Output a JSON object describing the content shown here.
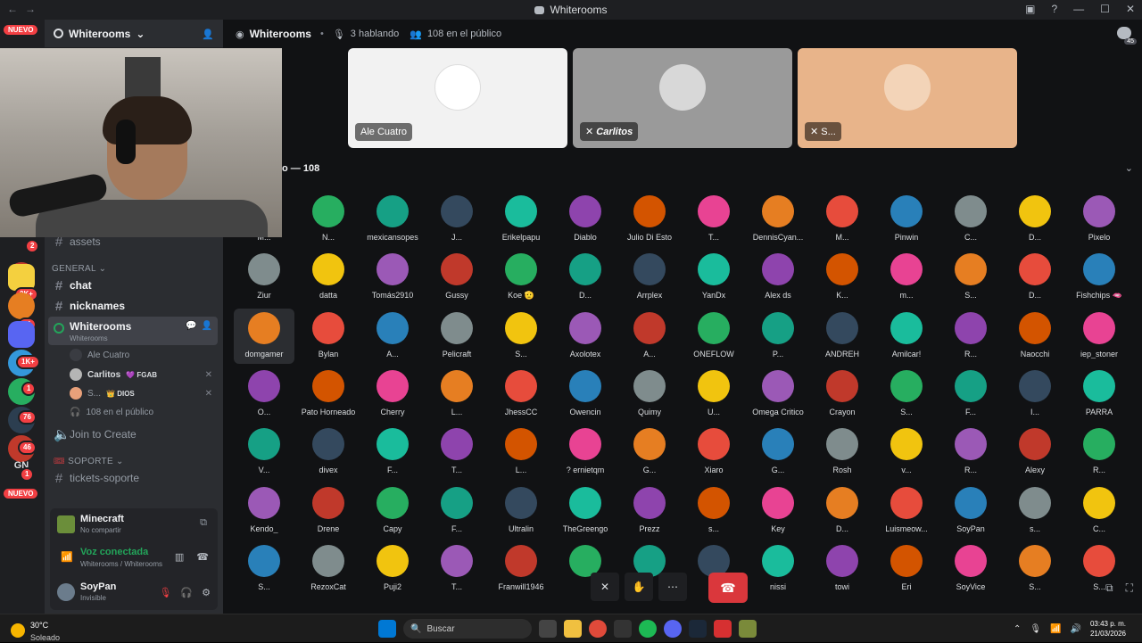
{
  "window": {
    "title": "Whiterooms"
  },
  "rail": {
    "nuevo_top": "NUEVO",
    "nuevo_bottom": "NUEVO",
    "gn": "GN",
    "badges": [
      "2",
      "2K+",
      "21",
      "1K+",
      "1",
      "76",
      "46",
      "1"
    ]
  },
  "sidebar": {
    "server_name": "Whiterooms",
    "channels_top": [
      {
        "label": "assets"
      }
    ],
    "category_general": "GENERAL",
    "channels_general": [
      {
        "label": "chat"
      },
      {
        "label": "nicknames"
      }
    ],
    "voice": {
      "name": "Whiterooms",
      "subtitle": "Whiterooms",
      "users": [
        {
          "name": "Ale Cuatro",
          "role": ""
        },
        {
          "name": "Carlitos",
          "role": "💜 FGAB"
        },
        {
          "name": "S...",
          "role": "👑 DIOS"
        }
      ],
      "audience": "108 en el público"
    },
    "join_to_create": "Join to Create",
    "category_soporte": "SOPORTE",
    "channels_soporte": [
      {
        "label": "tickets-soporte"
      }
    ]
  },
  "activity": {
    "game": "Minecraft",
    "sub": "No compartir"
  },
  "voice_status": {
    "title": "Voz conectada",
    "sub": "Whiterooms / Whiterooms"
  },
  "user": {
    "name": "SoyPan",
    "status": "Invisible"
  },
  "main": {
    "title": "Whiterooms",
    "speaking": "3 hablando",
    "audience": "108 en el público",
    "notif_count": "45",
    "speakers": [
      {
        "name": "Ale Cuatro"
      },
      {
        "name": "Carlitos"
      },
      {
        "name": "S..."
      }
    ],
    "audience_header": "o — 108",
    "grid_rows": [
      [
        "M...",
        "N...",
        "mexicansopes",
        "J...",
        "Erikelpapu",
        "Diablo",
        "Julio Di Esto",
        "T...",
        "DennisCyan...",
        "M...",
        "Pinwin",
        "C...",
        "D...",
        "Pixelo"
      ],
      [
        "Ziur",
        "datta",
        "Tomás2910",
        "Gussy",
        "Koe 🫡",
        "D...",
        "Arrplex",
        "YanDx",
        "Alex ds",
        "K...",
        "m...",
        "S...",
        "D...",
        "Fishchips 🫦"
      ],
      [
        "domgamer",
        "Bylan",
        "A...",
        "Pelicraft",
        "S...",
        "Axolotex",
        "A...",
        "ONEFLOW",
        "P...",
        "ANDREH",
        "Amilcar!",
        "R...",
        "Naocchi",
        "iep_stoner"
      ],
      [
        "O...",
        "Pato Horneado",
        "Cherry",
        "L...",
        "JhessCC",
        "Owencin",
        "Quimy",
        "U...",
        "Omega Critico",
        "Crayon",
        "S...",
        "F...",
        "I...",
        "PARRA"
      ],
      [
        "V...",
        "divex",
        "F...",
        "T...",
        "L...",
        "? ernietqm",
        "G...",
        "Xiaro",
        "G...",
        "Rosh",
        "v...",
        "R...",
        "Alexy",
        "R..."
      ],
      [
        "Kendo_",
        "Drene",
        "Capy",
        "F...",
        "Ultralin",
        "TheGreengo",
        "Prezz",
        "s...",
        "Key",
        "D...",
        "Luismeow...",
        "SoyPan",
        "s...",
        "C..."
      ],
      [
        "S...",
        "RezoxCat",
        "Puji2",
        "T...",
        "Franwill1946",
        "",
        "",
        "",
        "nissi",
        "towi",
        "Eri",
        "SoyVice",
        "S...",
        "S..."
      ]
    ]
  },
  "taskbar": {
    "temp": "30°C",
    "weather": "Soleado",
    "search_placeholder": "Buscar",
    "time": "03:43 p. m.",
    "date": "21/03/2026"
  },
  "colors": {
    "accent_green": "#23a55a",
    "danger": "#da373c",
    "badge_red": "#f23f43"
  }
}
